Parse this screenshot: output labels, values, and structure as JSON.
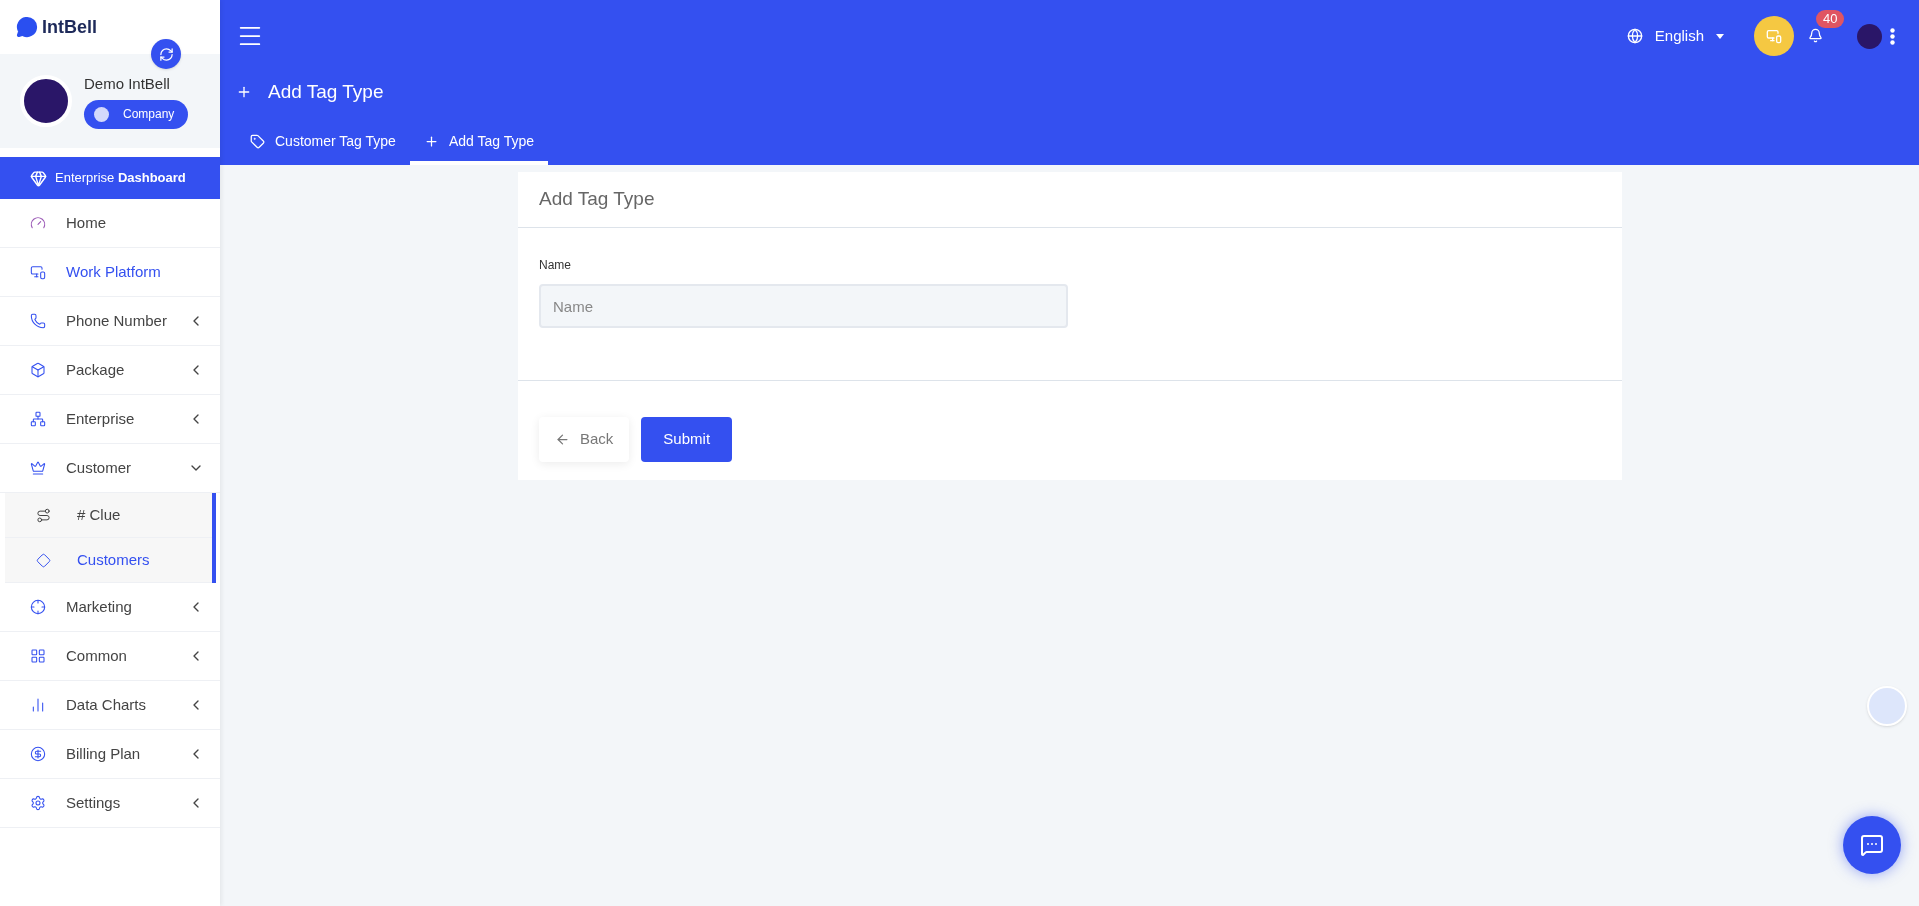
{
  "brand": {
    "name": "IntBell"
  },
  "profile": {
    "name": "Demo IntBell",
    "switch": {
      "label": "Company",
      "on": false
    }
  },
  "dashboard_link": "Enterprise **Dashboard**",
  "sidebar": {
    "items": [
      {
        "label": "Home",
        "selected": false
      },
      {
        "label": "Work Platform",
        "selected": true
      },
      {
        "label": "Phone Number",
        "selected": false,
        "expanded": false
      },
      {
        "label": "Package",
        "selected": false,
        "expanded": false
      },
      {
        "label": "Enterprise",
        "selected": false,
        "expanded": false
      },
      {
        "label": "Customer",
        "selected": false,
        "expanded": true,
        "children": [
          {
            "label": "# Clue",
            "selected": false
          },
          {
            "label": "Customers",
            "selected": true
          }
        ]
      },
      {
        "label": "Marketing",
        "selected": false,
        "expanded": false
      },
      {
        "label": "Common",
        "selected": false,
        "expanded": false
      },
      {
        "label": "Data Charts",
        "selected": false,
        "expanded": false
      },
      {
        "label": "Billing Plan",
        "selected": false,
        "expanded": false
      },
      {
        "label": "Settings",
        "selected": false,
        "expanded": false
      }
    ]
  },
  "header": {
    "language": "English",
    "notifications": "40",
    "page_title": "Add Tag Type"
  },
  "tabs": [
    {
      "label": "Customer Tag Type",
      "selected": false
    },
    {
      "label": "Add Tag Type",
      "selected": true
    }
  ],
  "form": {
    "title": "Add Tag Type",
    "fields": [
      {
        "label": "Name",
        "placeholder": "Name"
      }
    ],
    "buttons": [
      {
        "label": "Back",
        "kind": "back"
      },
      {
        "label": "Submit",
        "kind": "submit"
      }
    ]
  }
}
